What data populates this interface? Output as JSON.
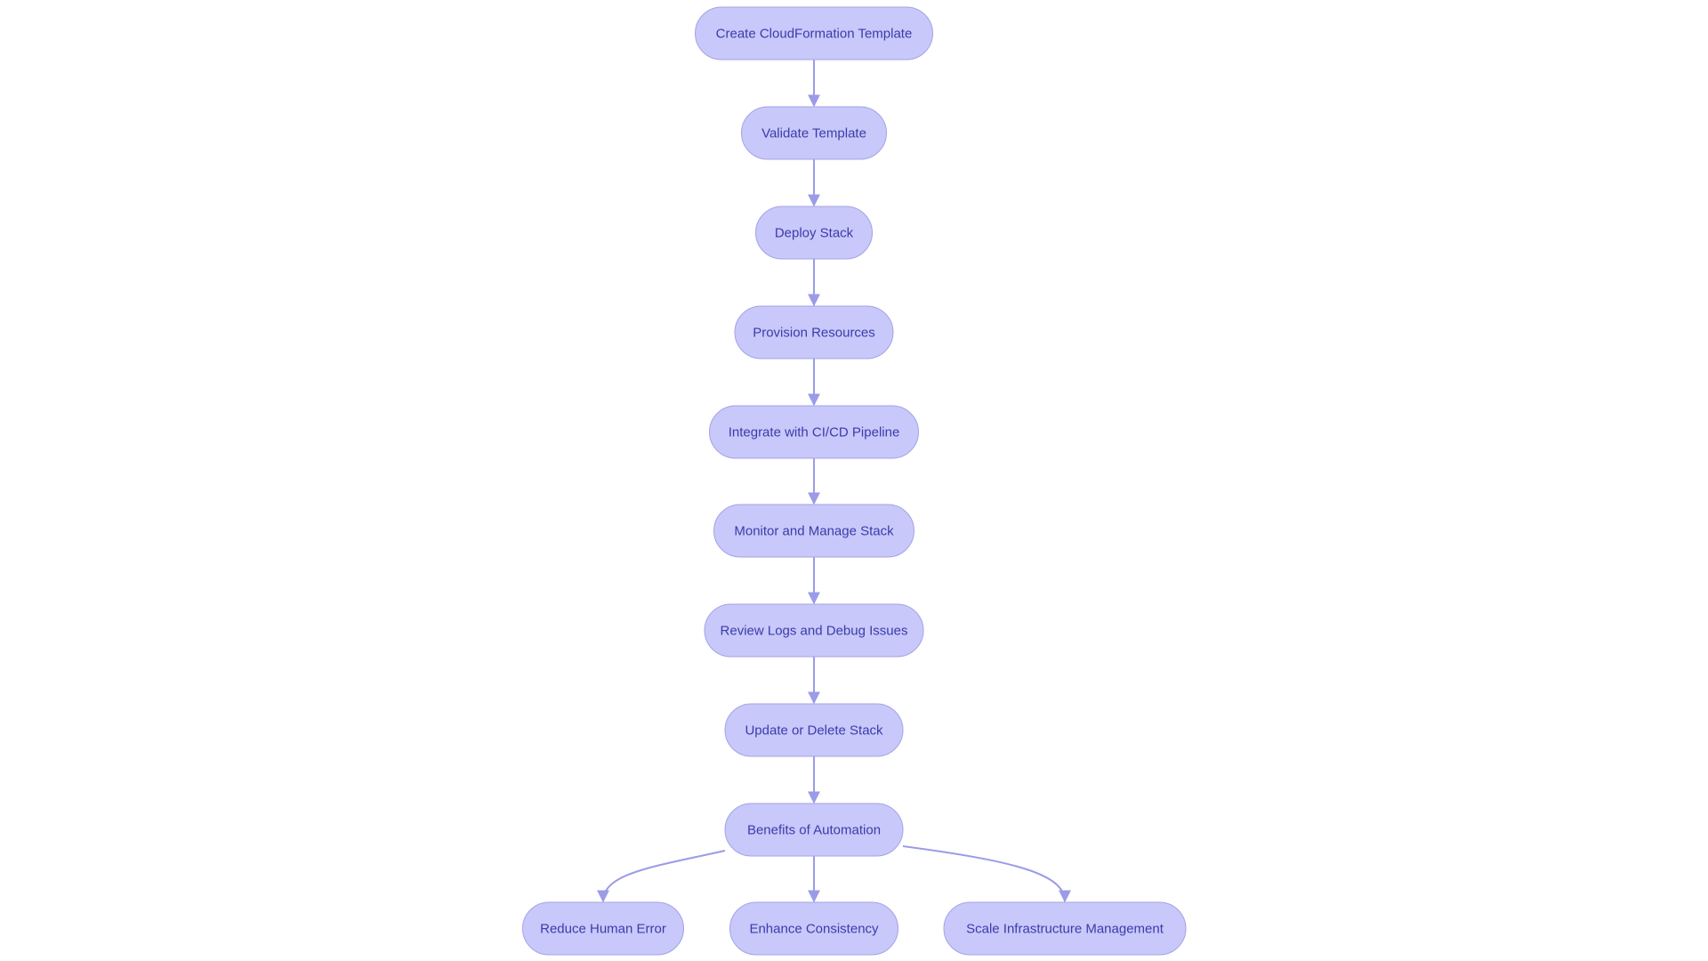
{
  "colors": {
    "node_fill": "#c8c8fa",
    "node_stroke": "#a3a3e6",
    "node_text": "#3b3bab",
    "edge": "#9b9be8",
    "background": "#ffffff"
  },
  "nodes": [
    {
      "id": "create",
      "label": "Create CloudFormation Template"
    },
    {
      "id": "validate",
      "label": "Validate Template"
    },
    {
      "id": "deploy",
      "label": "Deploy Stack"
    },
    {
      "id": "provision",
      "label": "Provision Resources"
    },
    {
      "id": "integrate",
      "label": "Integrate with CI/CD Pipeline"
    },
    {
      "id": "monitor",
      "label": "Monitor and Manage Stack"
    },
    {
      "id": "review",
      "label": "Review Logs and Debug Issues"
    },
    {
      "id": "update",
      "label": "Update or Delete Stack"
    },
    {
      "id": "benefits",
      "label": "Benefits of Automation"
    },
    {
      "id": "reduce",
      "label": "Reduce Human Error"
    },
    {
      "id": "enhance",
      "label": "Enhance Consistency"
    },
    {
      "id": "scale",
      "label": "Scale Infrastructure Management"
    }
  ],
  "edges": [
    {
      "from": "create",
      "to": "validate"
    },
    {
      "from": "validate",
      "to": "deploy"
    },
    {
      "from": "deploy",
      "to": "provision"
    },
    {
      "from": "provision",
      "to": "integrate"
    },
    {
      "from": "integrate",
      "to": "monitor"
    },
    {
      "from": "monitor",
      "to": "review"
    },
    {
      "from": "review",
      "to": "update"
    },
    {
      "from": "update",
      "to": "benefits"
    },
    {
      "from": "benefits",
      "to": "reduce"
    },
    {
      "from": "benefits",
      "to": "enhance"
    },
    {
      "from": "benefits",
      "to": "scale"
    }
  ]
}
